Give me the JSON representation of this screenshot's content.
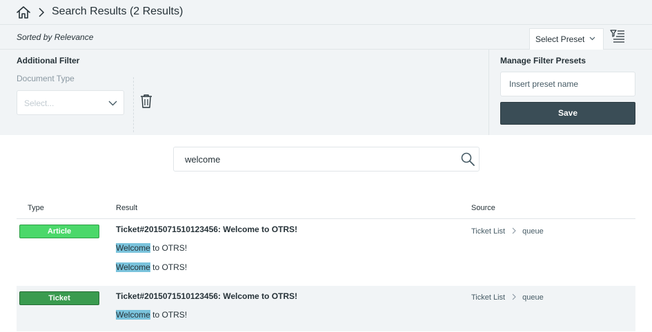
{
  "header": {
    "title": "Search Results (2 Results)"
  },
  "sortbar": {
    "sorted_label": "Sorted by Relevance",
    "preset_select_label": "Select Preset"
  },
  "filters": {
    "title": "Additional Filter",
    "document_type_label": "Document Type",
    "document_type_placeholder": "Select..."
  },
  "presets": {
    "title": "Manage Filter Presets",
    "name_placeholder": "Insert preset name",
    "save_label": "Save"
  },
  "search": {
    "value": "welcome"
  },
  "table": {
    "headers": {
      "type": "Type",
      "result": "Result",
      "source": "Source"
    },
    "rows": [
      {
        "type": "Article",
        "title": "Ticket#2015071510123456: Welcome to OTRS!",
        "snippets": [
          {
            "highlight": "Welcome",
            "rest": " to OTRS!"
          },
          {
            "highlight": "Welcome",
            "rest": " to OTRS!"
          }
        ],
        "source": {
          "list": "Ticket List",
          "queue": "queue"
        }
      },
      {
        "type": "Ticket",
        "title": "Ticket#2015071510123456: Welcome to OTRS!",
        "snippets": [
          {
            "highlight": "Welcome",
            "rest": " to OTRS!"
          }
        ],
        "source": {
          "list": "Ticket List",
          "queue": "queue"
        }
      }
    ]
  },
  "colors": {
    "article_badge": "#4bd86a",
    "ticket_badge": "#3a9b4f",
    "highlight": "#7ac3dc",
    "save_button": "#3a4d56",
    "panel_bg": "#f1f4f6"
  },
  "icons": {
    "home": "home-icon",
    "breadcrumb": "chevron-right-icon",
    "filter_toggle": "filter-list-icon",
    "delete": "trash-icon",
    "search": "search-icon",
    "dropdown": "chevron-down-icon"
  }
}
